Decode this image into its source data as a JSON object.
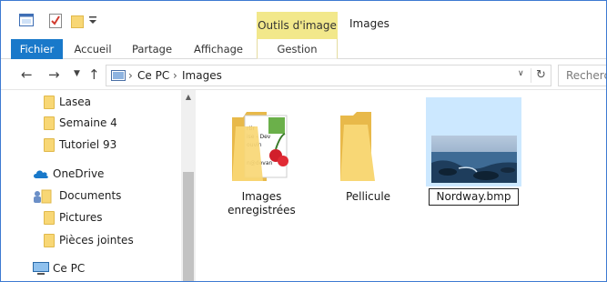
{
  "window": {
    "title": "Images",
    "contextual_tab": "Outils d'image"
  },
  "ribbon": {
    "tabs": [
      "Fichier",
      "Accueil",
      "Partage",
      "Affichage",
      "Gestion"
    ]
  },
  "address": {
    "crumbs": [
      "Ce PC",
      "Images"
    ],
    "search_placeholder": "Recherche"
  },
  "nav": {
    "items": [
      {
        "label": "Lasea",
        "icon": "folder-icon"
      },
      {
        "label": "Semaine 4",
        "icon": "folder-icon"
      },
      {
        "label": "Tutoriel 93",
        "icon": "folder-icon"
      },
      {
        "label": "OneDrive",
        "icon": "cloud-icon"
      },
      {
        "label": "Documents",
        "icon": "documents-icon"
      },
      {
        "label": "Pictures",
        "icon": "folder-icon"
      },
      {
        "label": "Pièces jointes",
        "icon": "folder-icon"
      },
      {
        "label": "Ce PC",
        "icon": "computer-icon"
      }
    ]
  },
  "content": {
    "items": [
      {
        "name_line1": "Images",
        "name_line2": "enregistrées",
        "type": "folder-with-preview"
      },
      {
        "name_line1": "Pellicule",
        "type": "folder"
      },
      {
        "name_line1": "Nordway.bmp",
        "type": "image",
        "selected": true,
        "renaming": true
      }
    ]
  },
  "colors": {
    "file_tab": "#1979ca",
    "contextual_tab": "#f2e88b",
    "selection": "#cce8ff",
    "folder": "#f8d775"
  }
}
